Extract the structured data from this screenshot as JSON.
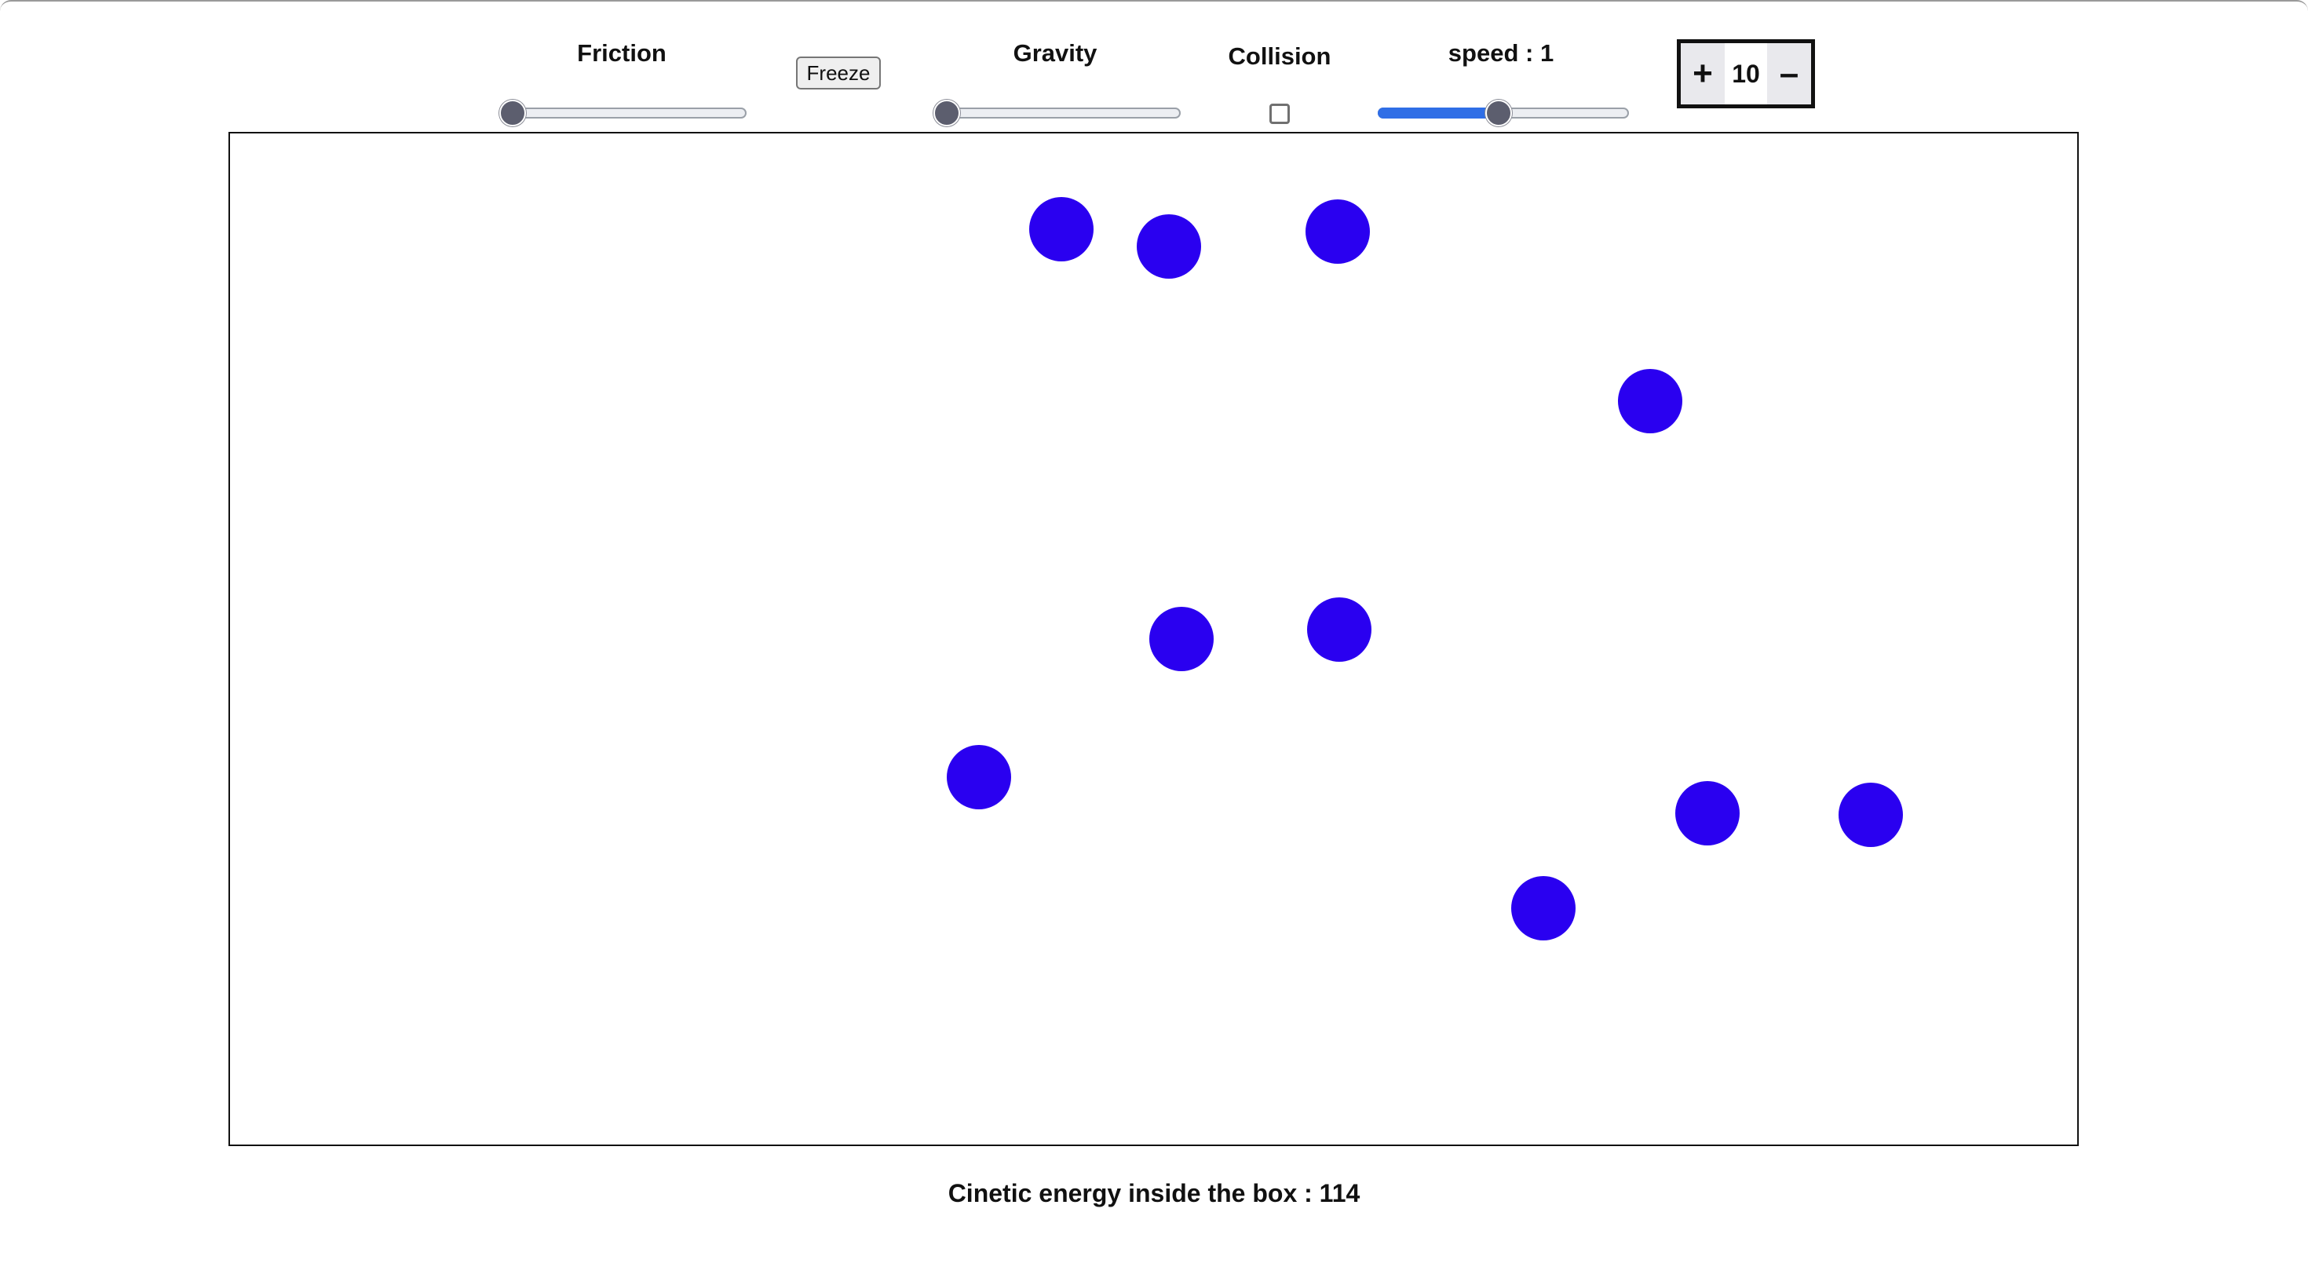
{
  "controls": {
    "friction": {
      "label": "Friction",
      "value": 0
    },
    "freeze": {
      "label": "Freeze"
    },
    "gravity": {
      "label": "Gravity",
      "value": 0
    },
    "collision": {
      "label": "Collision",
      "checked": false
    },
    "speed": {
      "label": "speed : 1",
      "value": 0.48
    },
    "counter": {
      "plus": "+",
      "value": "10",
      "minus": "–"
    }
  },
  "simulation": {
    "ball_color": "#2a00f0",
    "ball_count": 10
  },
  "footer": {
    "energy_text": "Cinetic energy inside the box : 114"
  },
  "colors": {
    "slider_fill": "#2f6ee6",
    "slider_thumb": "#5c5e6e"
  }
}
